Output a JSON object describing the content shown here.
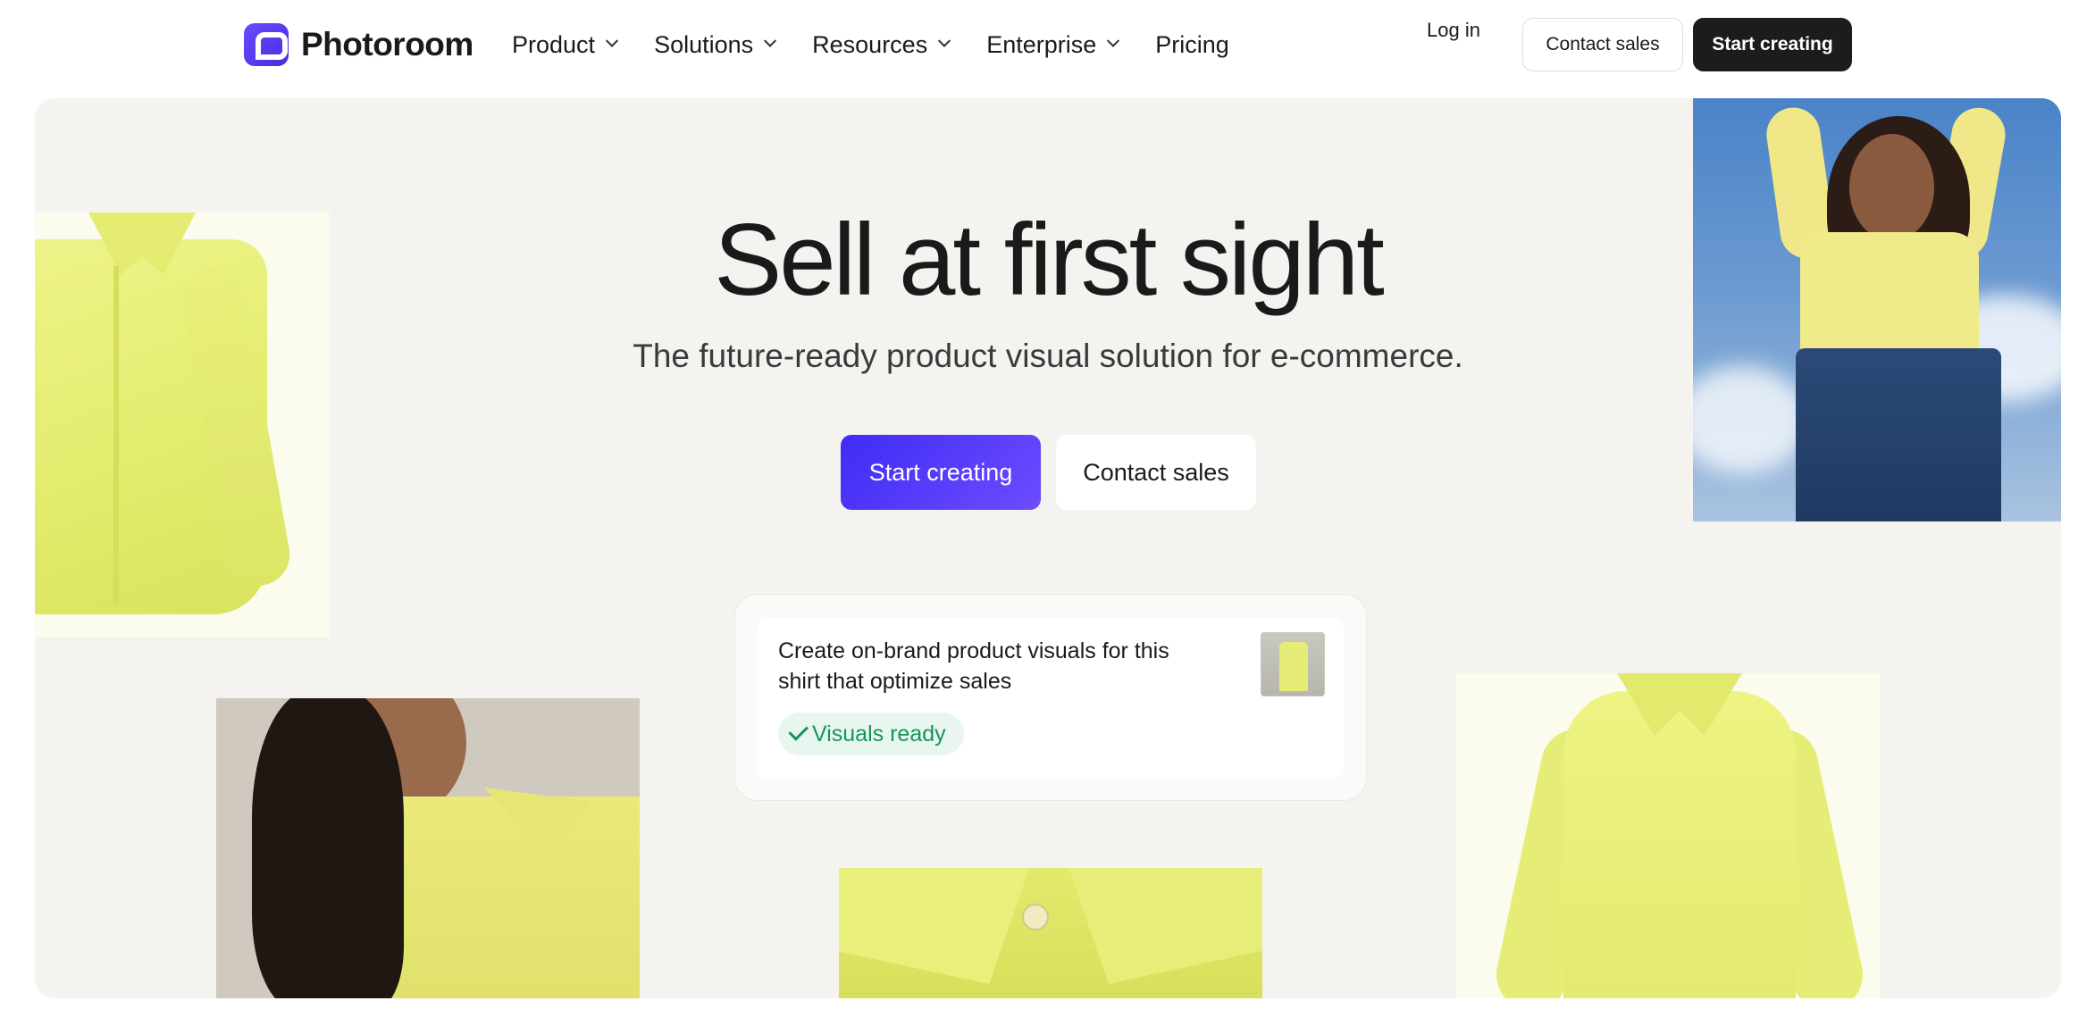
{
  "brand": {
    "name": "Photoroom",
    "accent": "#4a2be0"
  },
  "nav": {
    "items": [
      {
        "label": "Product",
        "has_dropdown": true
      },
      {
        "label": "Solutions",
        "has_dropdown": true
      },
      {
        "label": "Resources",
        "has_dropdown": true
      },
      {
        "label": "Enterprise",
        "has_dropdown": true
      },
      {
        "label": "Pricing",
        "has_dropdown": false
      }
    ],
    "login_label": "Log in",
    "contact_label": "Contact sales",
    "start_label": "Start creating"
  },
  "hero": {
    "headline": "Sell at first sight",
    "subheadline": "The future-ready product visual solution for e-commerce.",
    "primary_cta": "Start creating",
    "secondary_cta": "Contact sales",
    "prompt_card": {
      "text": "Create on-brand product visuals for this shirt that optimize sales",
      "status_label": "Visuals ready",
      "status_color": "#16955b"
    }
  }
}
